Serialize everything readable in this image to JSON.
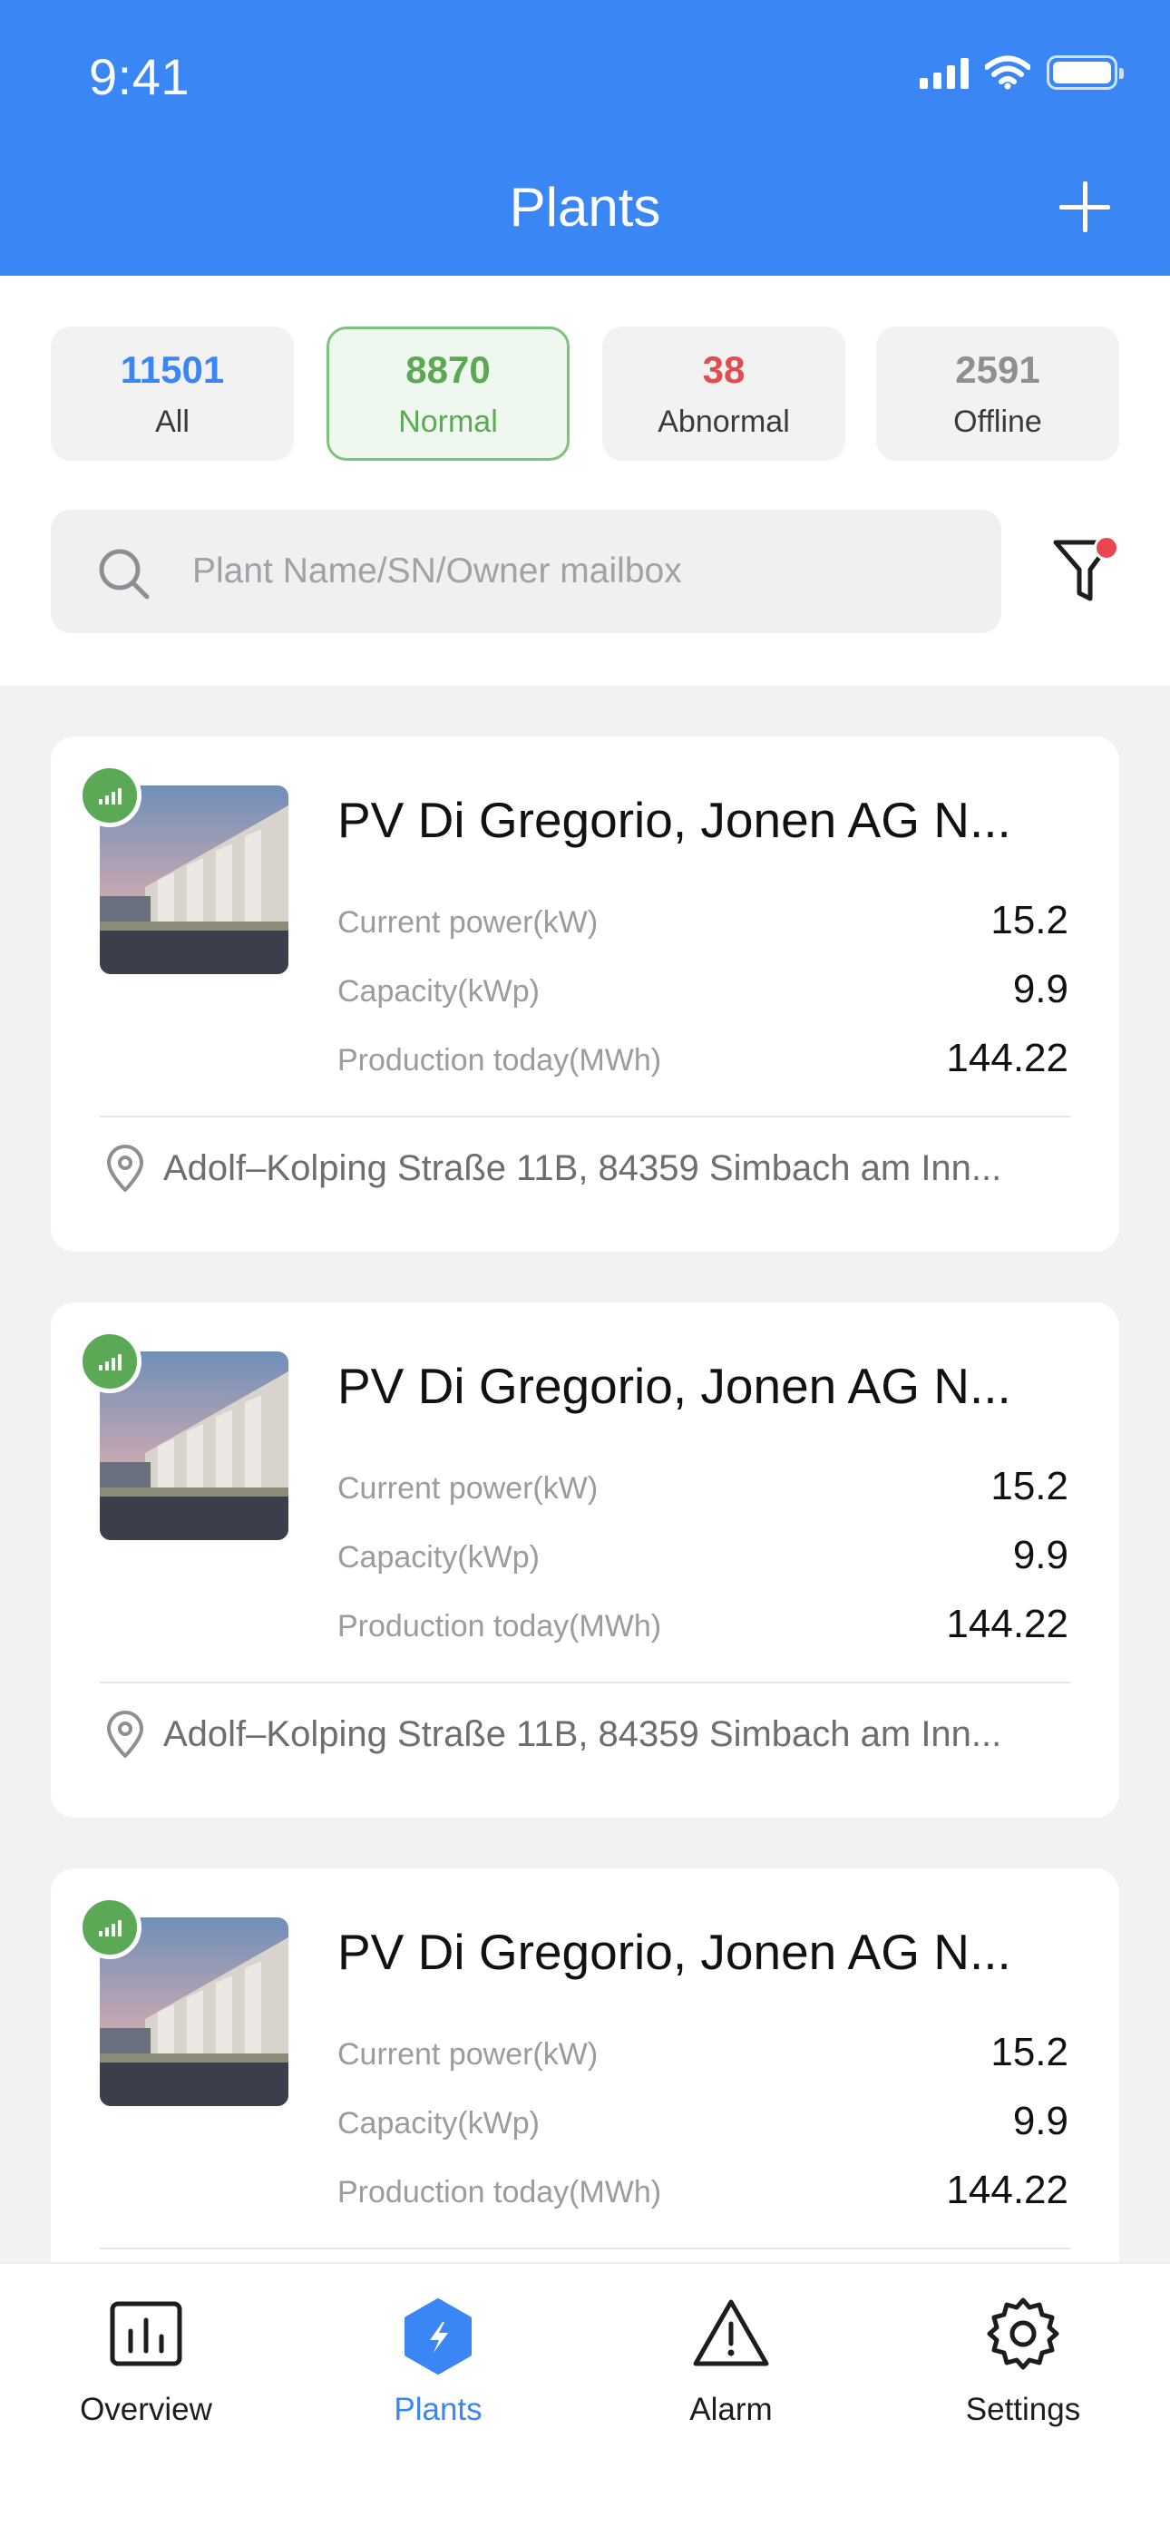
{
  "status_bar": {
    "time": "9:41"
  },
  "header": {
    "title": "Plants"
  },
  "tabs": [
    {
      "count": "11501",
      "label": "All",
      "color": "#3b86f5"
    },
    {
      "count": "8870",
      "label": "Normal",
      "color": "#5ba954"
    },
    {
      "count": "38",
      "label": "Abnormal",
      "color": "#e24b50"
    },
    {
      "count": "2591",
      "label": "Offline",
      "color": "#8e8e93"
    }
  ],
  "search": {
    "placeholder": "Plant Name/SN/Owner mailbox"
  },
  "plants": [
    {
      "name": "PV Di Gregorio, Jonen AG N...",
      "metrics": [
        {
          "label": "Current power(kW)",
          "value": "15.2"
        },
        {
          "label": "Capacity(kWp)",
          "value": "9.9"
        },
        {
          "label": "Production today(MWh)",
          "value": "144.22"
        }
      ],
      "address": "Adolf–Kolping Straße 11B, 84359 Simbach am Inn..."
    },
    {
      "name": "PV Di Gregorio, Jonen AG N...",
      "metrics": [
        {
          "label": "Current power(kW)",
          "value": "15.2"
        },
        {
          "label": "Capacity(kWp)",
          "value": "9.9"
        },
        {
          "label": "Production today(MWh)",
          "value": "144.22"
        }
      ],
      "address": "Adolf–Kolping Straße 11B, 84359 Simbach am Inn..."
    },
    {
      "name": "PV Di Gregorio, Jonen AG N...",
      "metrics": [
        {
          "label": "Current power(kW)",
          "value": "15.2"
        },
        {
          "label": "Capacity(kWp)",
          "value": "9.9"
        },
        {
          "label": "Production today(MWh)",
          "value": "144.22"
        }
      ],
      "address": ""
    }
  ],
  "nav": [
    {
      "label": "Overview",
      "icon": "overview-chart-icon"
    },
    {
      "label": "Plants",
      "icon": "plants-bolt-icon",
      "active": true
    },
    {
      "label": "Alarm",
      "icon": "alarm-warning-icon"
    },
    {
      "label": "Settings",
      "icon": "gear-icon"
    }
  ],
  "colors": {
    "accent": "#3b86f5",
    "normal": "#5ba954",
    "abnormal": "#e24b50",
    "offline": "#8e8e93"
  }
}
